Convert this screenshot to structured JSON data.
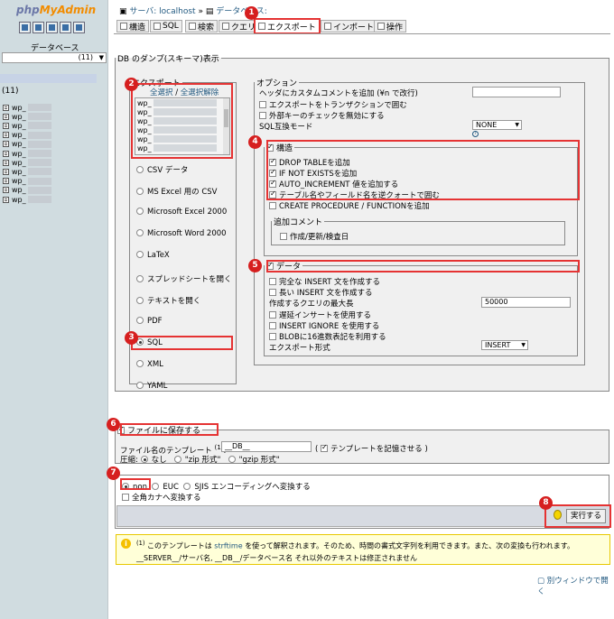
{
  "sidebar": {
    "logo_main": "php",
    "logo_my": "MyAdmin",
    "db_label": "データベース",
    "db_select_value": "(11)",
    "count": "(11)",
    "table_prefix": "wp_",
    "table_count": 11
  },
  "breadcrumb": {
    "server": "サーバ: localhost",
    "database": "データベース:"
  },
  "tabs": [
    {
      "label": "構造"
    },
    {
      "label": "SQL"
    },
    {
      "label": "検索"
    },
    {
      "label": "クエリ"
    },
    {
      "label": "エクスポート"
    },
    {
      "label": "インポート"
    },
    {
      "label": "操作"
    }
  ],
  "main_legend": "DB のダンプ(スキーマ)表示",
  "export": {
    "legend": "エクスポート",
    "select_all": "全選択",
    "separator": "/",
    "deselect_all": "全選択解除",
    "list_items": [
      "wp_",
      "wp_",
      "wp_",
      "wp_",
      "wp_",
      "wp_"
    ],
    "formats": [
      "CSV データ",
      "MS Excel 用の CSV",
      "Microsoft Excel 2000",
      "Microsoft Word 2000",
      "LaTeX",
      "スプレッドシートを開く",
      "テキストを開く",
      "PDF",
      "SQL",
      "XML",
      "YAML"
    ]
  },
  "options": {
    "legend": "オプション",
    "header_comment": "ヘッダにカスタムコメントを追加 (¥n で改行)",
    "transaction": "エクスポートをトランザクションで囲む",
    "fk_checks": "外部キーのチェックを無効にする",
    "sql_compat_label": "SQL互換モード",
    "sql_compat_value": "NONE",
    "structure": {
      "legend": "構造",
      "drop_table": "DROP TABLEを追加",
      "if_not_exists": "IF NOT EXISTSを追加",
      "auto_increment": "AUTO_INCREMENT 値を追加する",
      "backquotes": "テーブル名やフィールド名を逆クォートで囲む",
      "procedure": "CREATE PROCEDURE / FUNCTIONを追加",
      "add_comments_legend": "追加コメント",
      "timestamps": "作成/更新/検査日"
    },
    "data": {
      "legend": "データ",
      "complete_insert": "完全な INSERT 文を作成する",
      "extended_insert": "長い INSERT 文を作成する",
      "max_query_label": "作成するクエリの最大長",
      "max_query_value": "50000",
      "delayed_insert": "遅延インサートを使用する",
      "insert_ignore": "INSERT IGNORE を使用する",
      "hex_blob": "BLOBに16進数表記を利用する",
      "export_type_label": "エクスポート形式",
      "export_type_value": "INSERT"
    }
  },
  "save": {
    "legend": "ファイルに保存する",
    "template_label": "ファイル名のテンプレート",
    "template_sup": "(1)",
    "template_value": "__DB__",
    "remember_open": "(",
    "remember_label": "テンプレートを記憶させる",
    "remember_close": ")",
    "compression_label": "圧縮:",
    "compression_none": "なし",
    "compression_zip": "\"zip 形式\"",
    "compression_gzip": "\"gzip 形式\""
  },
  "encoding": {
    "non": "non",
    "euc": "EUC",
    "sjis": "SJIS",
    "convert_label": "エンコーディングへ変換する",
    "kana": "全角カナへ変換する"
  },
  "execute_label": "実行する",
  "note": {
    "sup": "(1)",
    "line1_a": "このテンプレートは",
    "line1_link": "strftime",
    "line1_b": "を使って解釈されます。そのため、時間の書式文字列を利用できます。また、次の変換も行われます。",
    "line2": "__SERVER__/サーバ名, __DB__/データベース名 それ以外のテキストは修正されません"
  },
  "new_window": "別ウィンドウで開く",
  "badges": [
    "1",
    "2",
    "3",
    "4",
    "5",
    "6",
    "7",
    "8"
  ],
  "colors": {
    "accent": "#e53333",
    "badge": "#d61f1f",
    "link": "#235a81"
  }
}
